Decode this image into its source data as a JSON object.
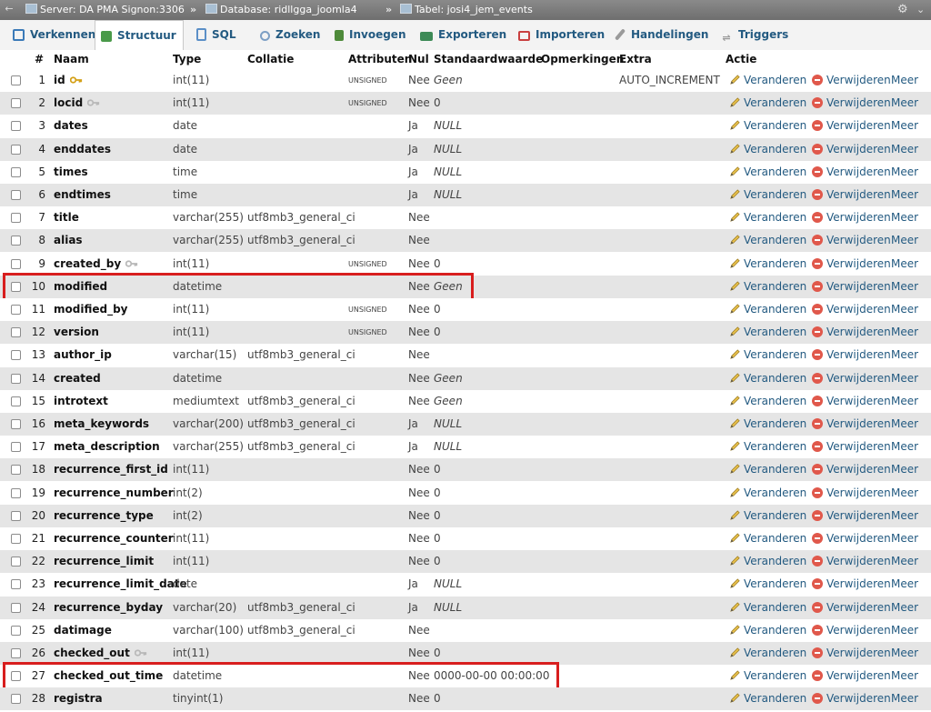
{
  "breadcrumb": {
    "server": "Server: DA PMA Signon:3306",
    "database": "Database: ridllgga_joomla4",
    "table": "Tabel: josi4_jem_events",
    "separator": "»"
  },
  "tabs": [
    {
      "label": "Verkennen",
      "icon": "browse-icon",
      "color": "#3b7ab8"
    },
    {
      "label": "Structuur",
      "icon": "structure-icon",
      "color": "#4a9a4a",
      "active": true
    },
    {
      "label": "SQL",
      "icon": "sql-icon",
      "color": "#5b8fc7"
    },
    {
      "label": "Zoeken",
      "icon": "search-icon",
      "color": "#7d9fc4"
    },
    {
      "label": "Invoegen",
      "icon": "insert-icon",
      "color": "#4e8a3a"
    },
    {
      "label": "Exporteren",
      "icon": "export-icon",
      "color": "#3d8a57"
    },
    {
      "label": "Importeren",
      "icon": "import-icon",
      "color": "#c94040"
    },
    {
      "label": "Handelingen",
      "icon": "wrench-icon",
      "color": "#8a8a8a"
    },
    {
      "label": "Triggers",
      "icon": "triggers-icon",
      "color": "#9a9a9a"
    }
  ],
  "columns": {
    "num": "#",
    "name": "Naam",
    "type": "Type",
    "collation": "Collatie",
    "attributes": "Attributen",
    "null": "Nul",
    "default": "Standaardwaarde",
    "comments": "Opmerkingen",
    "extra": "Extra",
    "action": "Actie"
  },
  "actions": {
    "edit": "Veranderen",
    "delete": "Verwijderen",
    "more": "Meer"
  },
  "rows": [
    {
      "num": "1",
      "name": "id",
      "key": "primary",
      "type": "int(11)",
      "collation": "",
      "attr": "UNSIGNED",
      "null": "Nee",
      "default": "Geen",
      "default_italic": true,
      "extra": "AUTO_INCREMENT"
    },
    {
      "num": "2",
      "name": "locid",
      "key": "index",
      "type": "int(11)",
      "collation": "",
      "attr": "UNSIGNED",
      "null": "Nee",
      "default": "0",
      "default_italic": false,
      "extra": ""
    },
    {
      "num": "3",
      "name": "dates",
      "key": "",
      "type": "date",
      "collation": "",
      "attr": "",
      "null": "Ja",
      "default": "NULL",
      "default_italic": true,
      "extra": ""
    },
    {
      "num": "4",
      "name": "enddates",
      "key": "",
      "type": "date",
      "collation": "",
      "attr": "",
      "null": "Ja",
      "default": "NULL",
      "default_italic": true,
      "extra": ""
    },
    {
      "num": "5",
      "name": "times",
      "key": "",
      "type": "time",
      "collation": "",
      "attr": "",
      "null": "Ja",
      "default": "NULL",
      "default_italic": true,
      "extra": ""
    },
    {
      "num": "6",
      "name": "endtimes",
      "key": "",
      "type": "time",
      "collation": "",
      "attr": "",
      "null": "Ja",
      "default": "NULL",
      "default_italic": true,
      "extra": ""
    },
    {
      "num": "7",
      "name": "title",
      "key": "",
      "type": "varchar(255)",
      "collation": "utf8mb3_general_ci",
      "attr": "",
      "null": "Nee",
      "default": "",
      "default_italic": false,
      "extra": ""
    },
    {
      "num": "8",
      "name": "alias",
      "key": "",
      "type": "varchar(255)",
      "collation": "utf8mb3_general_ci",
      "attr": "",
      "null": "Nee",
      "default": "",
      "default_italic": false,
      "extra": ""
    },
    {
      "num": "9",
      "name": "created_by",
      "key": "index",
      "type": "int(11)",
      "collation": "",
      "attr": "UNSIGNED",
      "null": "Nee",
      "default": "0",
      "default_italic": false,
      "extra": ""
    },
    {
      "num": "10",
      "name": "modified",
      "key": "",
      "type": "datetime",
      "collation": "",
      "attr": "",
      "null": "Nee",
      "default": "Geen",
      "default_italic": true,
      "extra": "",
      "highlight": true
    },
    {
      "num": "11",
      "name": "modified_by",
      "key": "",
      "type": "int(11)",
      "collation": "",
      "attr": "UNSIGNED",
      "null": "Nee",
      "default": "0",
      "default_italic": false,
      "extra": ""
    },
    {
      "num": "12",
      "name": "version",
      "key": "",
      "type": "int(11)",
      "collation": "",
      "attr": "UNSIGNED",
      "null": "Nee",
      "default": "0",
      "default_italic": false,
      "extra": ""
    },
    {
      "num": "13",
      "name": "author_ip",
      "key": "",
      "type": "varchar(15)",
      "collation": "utf8mb3_general_ci",
      "attr": "",
      "null": "Nee",
      "default": "",
      "default_italic": false,
      "extra": ""
    },
    {
      "num": "14",
      "name": "created",
      "key": "",
      "type": "datetime",
      "collation": "",
      "attr": "",
      "null": "Nee",
      "default": "Geen",
      "default_italic": true,
      "extra": ""
    },
    {
      "num": "15",
      "name": "introtext",
      "key": "",
      "type": "mediumtext",
      "collation": "utf8mb3_general_ci",
      "attr": "",
      "null": "Nee",
      "default": "Geen",
      "default_italic": true,
      "extra": ""
    },
    {
      "num": "16",
      "name": "meta_keywords",
      "key": "",
      "type": "varchar(200)",
      "collation": "utf8mb3_general_ci",
      "attr": "",
      "null": "Ja",
      "default": "NULL",
      "default_italic": true,
      "extra": ""
    },
    {
      "num": "17",
      "name": "meta_description",
      "key": "",
      "type": "varchar(255)",
      "collation": "utf8mb3_general_ci",
      "attr": "",
      "null": "Ja",
      "default": "NULL",
      "default_italic": true,
      "extra": ""
    },
    {
      "num": "18",
      "name": "recurrence_first_id",
      "key": "",
      "type": "int(11)",
      "collation": "",
      "attr": "",
      "null": "Nee",
      "default": "0",
      "default_italic": false,
      "extra": ""
    },
    {
      "num": "19",
      "name": "recurrence_number",
      "key": "",
      "type": "int(2)",
      "collation": "",
      "attr": "",
      "null": "Nee",
      "default": "0",
      "default_italic": false,
      "extra": ""
    },
    {
      "num": "20",
      "name": "recurrence_type",
      "key": "",
      "type": "int(2)",
      "collation": "",
      "attr": "",
      "null": "Nee",
      "default": "0",
      "default_italic": false,
      "extra": ""
    },
    {
      "num": "21",
      "name": "recurrence_counter",
      "key": "",
      "type": "int(11)",
      "collation": "",
      "attr": "",
      "null": "Nee",
      "default": "0",
      "default_italic": false,
      "extra": ""
    },
    {
      "num": "22",
      "name": "recurrence_limit",
      "key": "",
      "type": "int(11)",
      "collation": "",
      "attr": "",
      "null": "Nee",
      "default": "0",
      "default_italic": false,
      "extra": ""
    },
    {
      "num": "23",
      "name": "recurrence_limit_date",
      "key": "",
      "type": "date",
      "collation": "",
      "attr": "",
      "null": "Ja",
      "default": "NULL",
      "default_italic": true,
      "extra": ""
    },
    {
      "num": "24",
      "name": "recurrence_byday",
      "key": "",
      "type": "varchar(20)",
      "collation": "utf8mb3_general_ci",
      "attr": "",
      "null": "Ja",
      "default": "NULL",
      "default_italic": true,
      "extra": ""
    },
    {
      "num": "25",
      "name": "datimage",
      "key": "",
      "type": "varchar(100)",
      "collation": "utf8mb3_general_ci",
      "attr": "",
      "null": "Nee",
      "default": "",
      "default_italic": false,
      "extra": ""
    },
    {
      "num": "26",
      "name": "checked_out",
      "key": "index",
      "type": "int(11)",
      "collation": "",
      "attr": "",
      "null": "Nee",
      "default": "0",
      "default_italic": false,
      "extra": ""
    },
    {
      "num": "27",
      "name": "checked_out_time",
      "key": "",
      "type": "datetime",
      "collation": "",
      "attr": "",
      "null": "Nee",
      "default": "0000-00-00 00:00:00",
      "default_italic": false,
      "extra": "",
      "highlight": true
    },
    {
      "num": "28",
      "name": "registra",
      "key": "",
      "type": "tinyint(1)",
      "collation": "",
      "attr": "",
      "null": "Nee",
      "default": "0",
      "default_italic": false,
      "extra": ""
    }
  ],
  "colors": {
    "highlight": "#d81e1e",
    "link": "#235a81",
    "row_alt": "#e5e5e5"
  }
}
